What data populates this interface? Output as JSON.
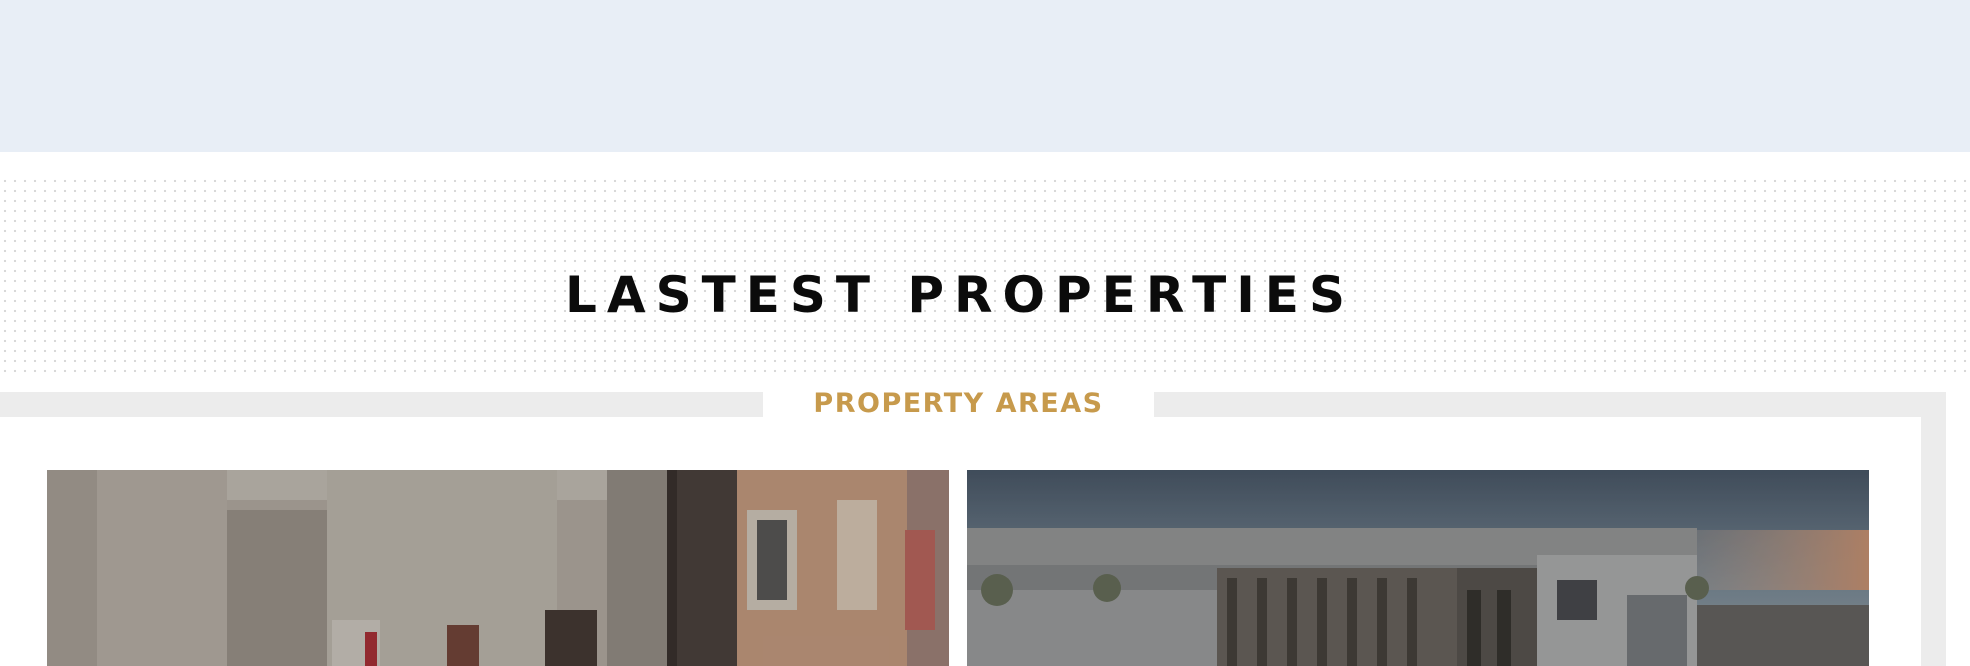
{
  "section": {
    "title": "LASTEST PROPERTIES",
    "subtitle": "PROPERTY AREAS"
  },
  "cards": [
    {
      "image": "apartment-interior-photo"
    },
    {
      "image": "apartment-building-exterior-photo"
    }
  ],
  "colors": {
    "top_band": "#e8eef6",
    "accent": "#c79a4c",
    "frame": "#ececec",
    "title": "#0b0b0b"
  }
}
